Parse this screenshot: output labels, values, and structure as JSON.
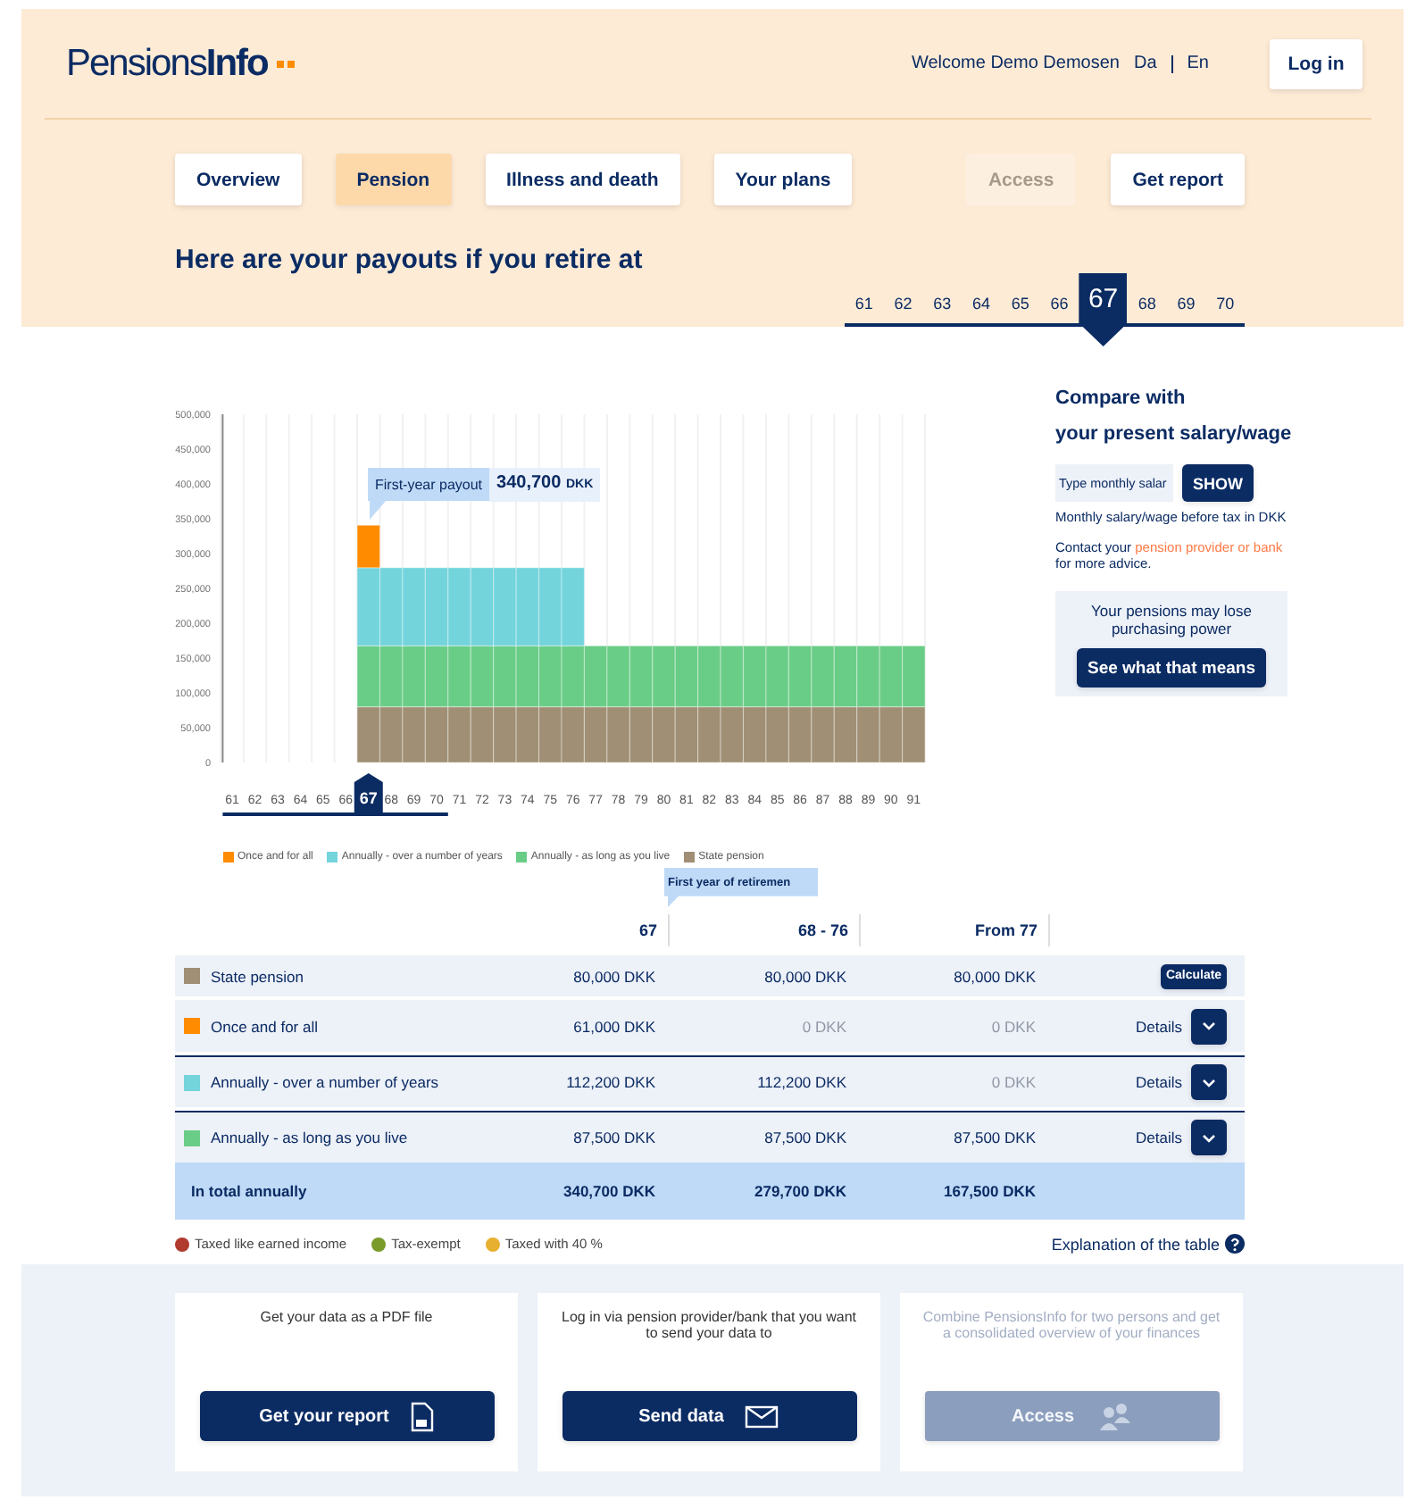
{
  "header": {
    "logo": "Pensions**Info**",
    "welcome": "Welcome Demo Demosen",
    "languages": [
      "Da",
      "En"
    ],
    "login_button": "Log in"
  },
  "nav": {
    "tabs": [
      {
        "label": "Overview",
        "selected": false
      },
      {
        "label": "Pension",
        "selected": true
      },
      {
        "label": "Illness and death",
        "selected": false
      },
      {
        "label": "Your plans",
        "selected": false
      }
    ],
    "actions": [
      {
        "label": "Access",
        "disabled": true
      },
      {
        "label": "Get report",
        "disabled": false
      }
    ]
  },
  "title": "Here are your payouts if you retire at",
  "retirement_ages": [
    {
      "label": "61",
      "selected": false
    },
    {
      "label": "62",
      "selected": false
    },
    {
      "label": "63",
      "selected": false
    },
    {
      "label": "64",
      "selected": false
    },
    {
      "label": "65",
      "selected": false
    },
    {
      "label": "66",
      "selected": false
    },
    {
      "label": "67",
      "selected": true
    },
    {
      "label": "68",
      "selected": false
    },
    {
      "label": "69",
      "selected": false
    },
    {
      "label": "70",
      "selected": false
    }
  ],
  "chart": {
    "marker_category": "67",
    "tooltip": {
      "label": "First-year payout",
      "value": "340,700",
      "unit": "DKK"
    },
    "chart_data": {
      "type": "bar",
      "stacked": true,
      "categories": [
        "61",
        "62",
        "63",
        "64",
        "65",
        "66",
        "67",
        "68",
        "69",
        "70",
        "71",
        "72",
        "73",
        "74",
        "75",
        "76",
        "77",
        "78",
        "79",
        "80",
        "81",
        "82",
        "83",
        "84",
        "85",
        "86",
        "87",
        "88",
        "89",
        "90",
        "91"
      ],
      "series": [
        {
          "name": "Once and for all",
          "color": "#ff8c00",
          "values": [
            null,
            null,
            null,
            null,
            null,
            null,
            61000,
            0,
            0,
            0,
            0,
            0,
            0,
            0,
            0,
            0,
            0,
            0,
            0,
            0,
            0,
            0,
            0,
            0,
            0,
            0,
            0,
            0,
            0,
            0,
            0
          ]
        },
        {
          "name": "Annually - over a number of years",
          "color": "#73d4dc",
          "values": [
            null,
            null,
            null,
            null,
            null,
            null,
            112200,
            112200,
            112200,
            112200,
            112200,
            112200,
            112200,
            112200,
            112200,
            112200,
            0,
            0,
            0,
            0,
            0,
            0,
            0,
            0,
            0,
            0,
            0,
            0,
            0,
            0,
            0
          ]
        },
        {
          "name": "Annually - as long as you live",
          "color": "#6acd87",
          "values": [
            null,
            null,
            null,
            null,
            null,
            null,
            87500,
            87500,
            87500,
            87500,
            87500,
            87500,
            87500,
            87500,
            87500,
            87500,
            87500,
            87500,
            87500,
            87500,
            87500,
            87500,
            87500,
            87500,
            87500,
            87500,
            87500,
            87500,
            87500,
            87500,
            87500
          ]
        },
        {
          "name": "State pension",
          "color": "#a08f74",
          "values": [
            null,
            null,
            null,
            null,
            null,
            null,
            80000,
            80000,
            80000,
            80000,
            80000,
            80000,
            80000,
            80000,
            80000,
            80000,
            80000,
            80000,
            80000,
            80000,
            80000,
            80000,
            80000,
            80000,
            80000,
            80000,
            80000,
            80000,
            80000,
            80000,
            80000
          ]
        }
      ],
      "legend": "bottom",
      "ylim": [
        0,
        500000
      ],
      "yticks": [
        {
          "value": 0,
          "label": "0"
        },
        {
          "value": 50000,
          "label": "50,000"
        },
        {
          "value": 100000,
          "label": "100,000"
        },
        {
          "value": 150000,
          "label": "150,000"
        },
        {
          "value": 200000,
          "label": "200,000"
        },
        {
          "value": 250000,
          "label": "250,000"
        },
        {
          "value": 300000,
          "label": "300,000"
        },
        {
          "value": 350000,
          "label": "350,000"
        },
        {
          "value": 400000,
          "label": "400,000"
        },
        {
          "value": 450000,
          "label": "450,000"
        },
        {
          "value": 500000,
          "label": "500,000"
        }
      ]
    }
  },
  "compare": {
    "heading_lines": [
      "Compare with",
      "your present salary/wage"
    ],
    "input_placeholder": "Type monthly salar",
    "show_button": "SHOW",
    "hint": "Monthly salary/wage before tax in DKK",
    "contact_before": "Contact your",
    "contact_link": "pension provider or bank",
    "contact_after": "for more advice."
  },
  "purchasing_power": {
    "text": "Your pensions may lose purchasing power",
    "button": "See what that means"
  },
  "table": {
    "first_year_tooltip": "First year of retiremen",
    "columns": [
      "67",
      "68 - 76",
      "From 77"
    ],
    "rows": [
      {
        "label": "State pension",
        "color": "#a08f74",
        "rule_above": false,
        "cells": [
          {
            "text": "80,000 DKK",
            "muted": false
          },
          {
            "text": "80,000 DKK",
            "muted": false
          },
          {
            "text": "80,000 DKK",
            "muted": false
          }
        ],
        "action": {
          "kind": "calculate",
          "label": "Calculate"
        }
      },
      {
        "label": "Once and for all",
        "color": "#ff8c00",
        "rule_above": false,
        "cells": [
          {
            "text": "61,000 DKK",
            "muted": false
          },
          {
            "text": "0 DKK",
            "muted": true
          },
          {
            "text": "0 DKK",
            "muted": true
          }
        ],
        "action": {
          "kind": "details",
          "label": "Details"
        }
      },
      {
        "label": "Annually - over a number of years",
        "color": "#73d4dc",
        "rule_above": true,
        "cells": [
          {
            "text": "112,200 DKK",
            "muted": false
          },
          {
            "text": "112,200 DKK",
            "muted": false
          },
          {
            "text": "0 DKK",
            "muted": true
          }
        ],
        "action": {
          "kind": "details",
          "label": "Details"
        }
      },
      {
        "label": "Annually - as long as you live",
        "color": "#6acd87",
        "rule_above": true,
        "cells": [
          {
            "text": "87,500 DKK",
            "muted": false
          },
          {
            "text": "87,500 DKK",
            "muted": false
          },
          {
            "text": "87,500 DKK",
            "muted": false
          }
        ],
        "action": {
          "kind": "details",
          "label": "Details"
        }
      }
    ],
    "total": {
      "label": "In total annually",
      "cells": [
        "340,700 DKK",
        "279,700 DKK",
        "167,500 DKK"
      ]
    },
    "tax_legend": [
      {
        "label": "Taxed like earned income",
        "color": "#b03a2e"
      },
      {
        "label": "Tax-exempt",
        "color": "#7a9a2a"
      },
      {
        "label": "Taxed with 40 %",
        "color": "#e8b030"
      }
    ],
    "explanation_link": "Explanation of the table"
  },
  "cards": [
    {
      "text": "Get your data as a PDF file",
      "button": "Get your report",
      "kind": "report",
      "disabled": false
    },
    {
      "text": "Log in via pension provider/bank that you want to send your data to",
      "button": "Send data",
      "kind": "send",
      "disabled": false
    },
    {
      "text": "Combine PensionsInfo for two persons and get a consolidated overview of your finances",
      "button": "Access",
      "kind": "access",
      "disabled": true
    }
  ]
}
